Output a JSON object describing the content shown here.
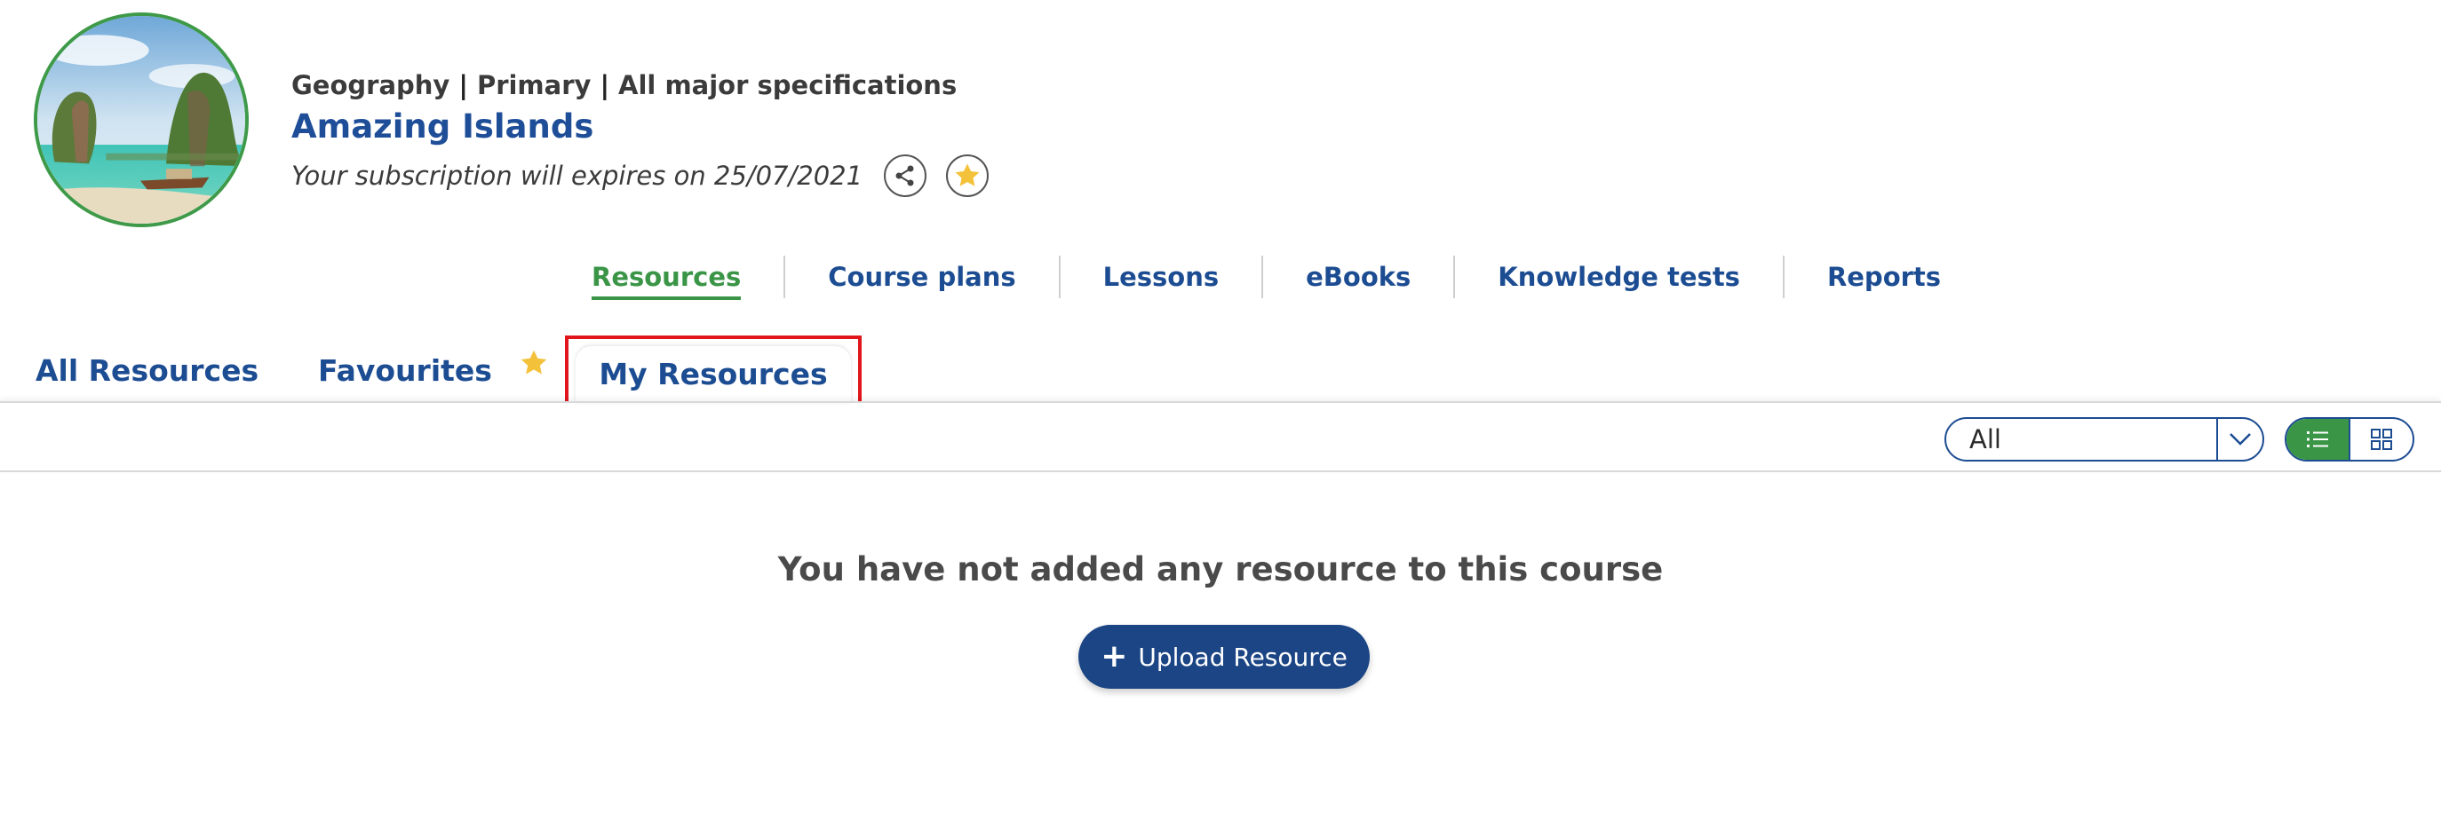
{
  "header": {
    "breadcrumb": [
      "Geography",
      "Primary",
      "All major specifications"
    ],
    "breadcrumb_separator": "|",
    "course_title": "Amazing Islands",
    "expiry_text": "Your subscription will expires on 25/07/2021",
    "icons": {
      "share": "share-icon",
      "favourite": "star-icon",
      "course_image": "island-photo"
    }
  },
  "main_nav": {
    "items": [
      {
        "label": "Resources",
        "active": true
      },
      {
        "label": "Course plans",
        "active": false
      },
      {
        "label": "Lessons",
        "active": false
      },
      {
        "label": "eBooks",
        "active": false
      },
      {
        "label": "Knowledge tests",
        "active": false
      },
      {
        "label": "Reports",
        "active": false
      }
    ]
  },
  "sub_tabs": {
    "all": "All Resources",
    "favourites": "Favourites",
    "my": "My Resources",
    "active": "my"
  },
  "toolbar": {
    "filter_value": "All",
    "view_modes": [
      "list",
      "grid"
    ],
    "active_view": "list"
  },
  "content": {
    "empty_message": "You have not added any resource to this course",
    "upload_label": "Upload Resource"
  },
  "colors": {
    "brand_blue": "#1c4c92",
    "accent_green": "#3a9547",
    "star_yellow": "#f3c13a",
    "highlight_red": "#e0161c",
    "button_blue": "#1b4585"
  }
}
